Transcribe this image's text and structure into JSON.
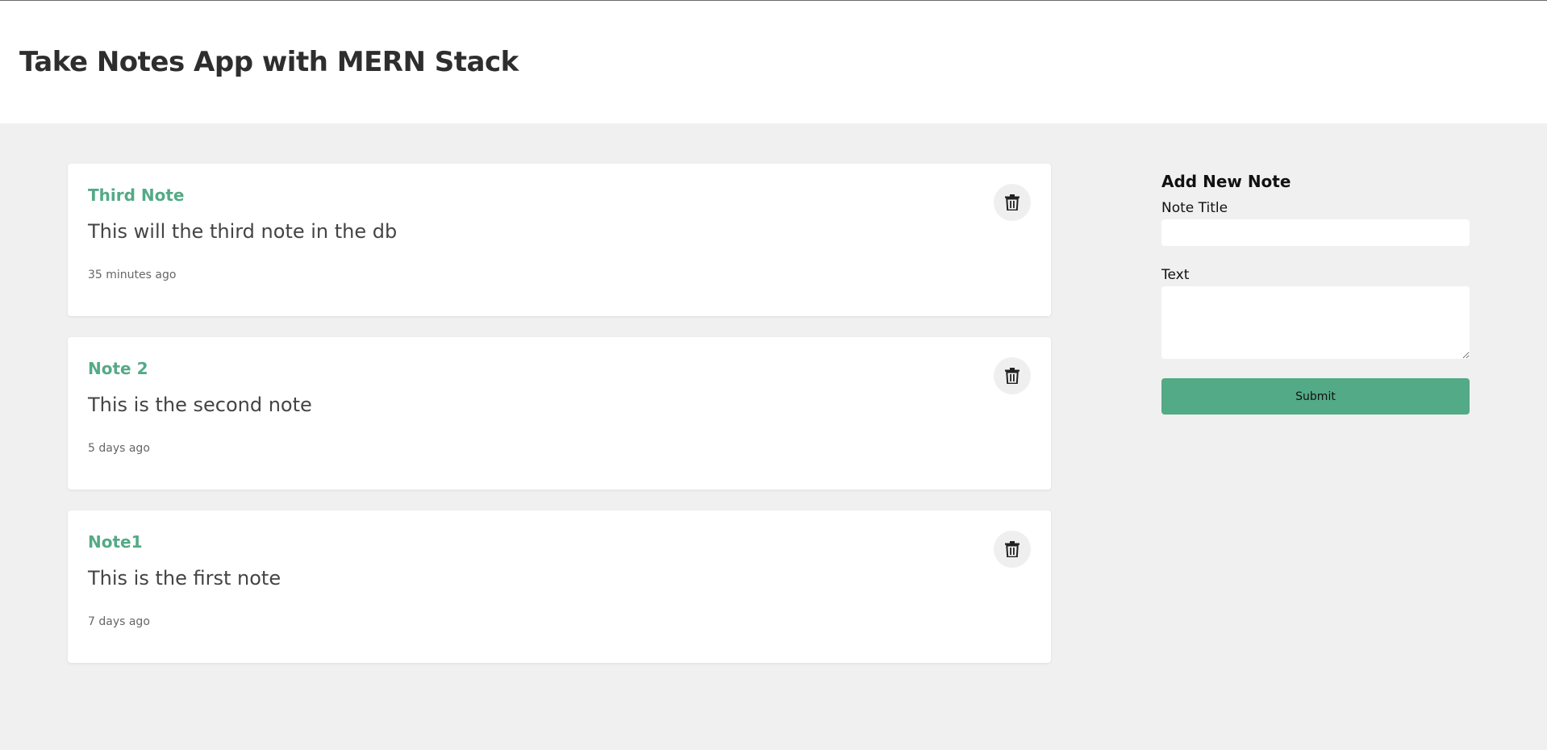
{
  "app": {
    "title": "Take Notes App with MERN Stack"
  },
  "notes": [
    {
      "title": "Third Note",
      "text": "This will the third note in the db",
      "time": "35 minutes ago",
      "delete_icon": "trash-icon"
    },
    {
      "title": "Note 2",
      "text": "This is the second note",
      "time": "5 days ago",
      "delete_icon": "trash-icon"
    },
    {
      "title": "Note1",
      "text": "This is the first note",
      "time": "7 days ago",
      "delete_icon": "trash-icon"
    }
  ],
  "form": {
    "heading": "Add New Note",
    "title_label": "Note Title",
    "title_value": "",
    "text_label": "Text",
    "text_value": "",
    "submit_label": "Submit"
  },
  "colors": {
    "accent": "#54aa86",
    "page_bg": "#f0f0f0",
    "header_bg": "#ffffff",
    "card_bg": "#ffffff",
    "delete_bg": "#efefef"
  }
}
